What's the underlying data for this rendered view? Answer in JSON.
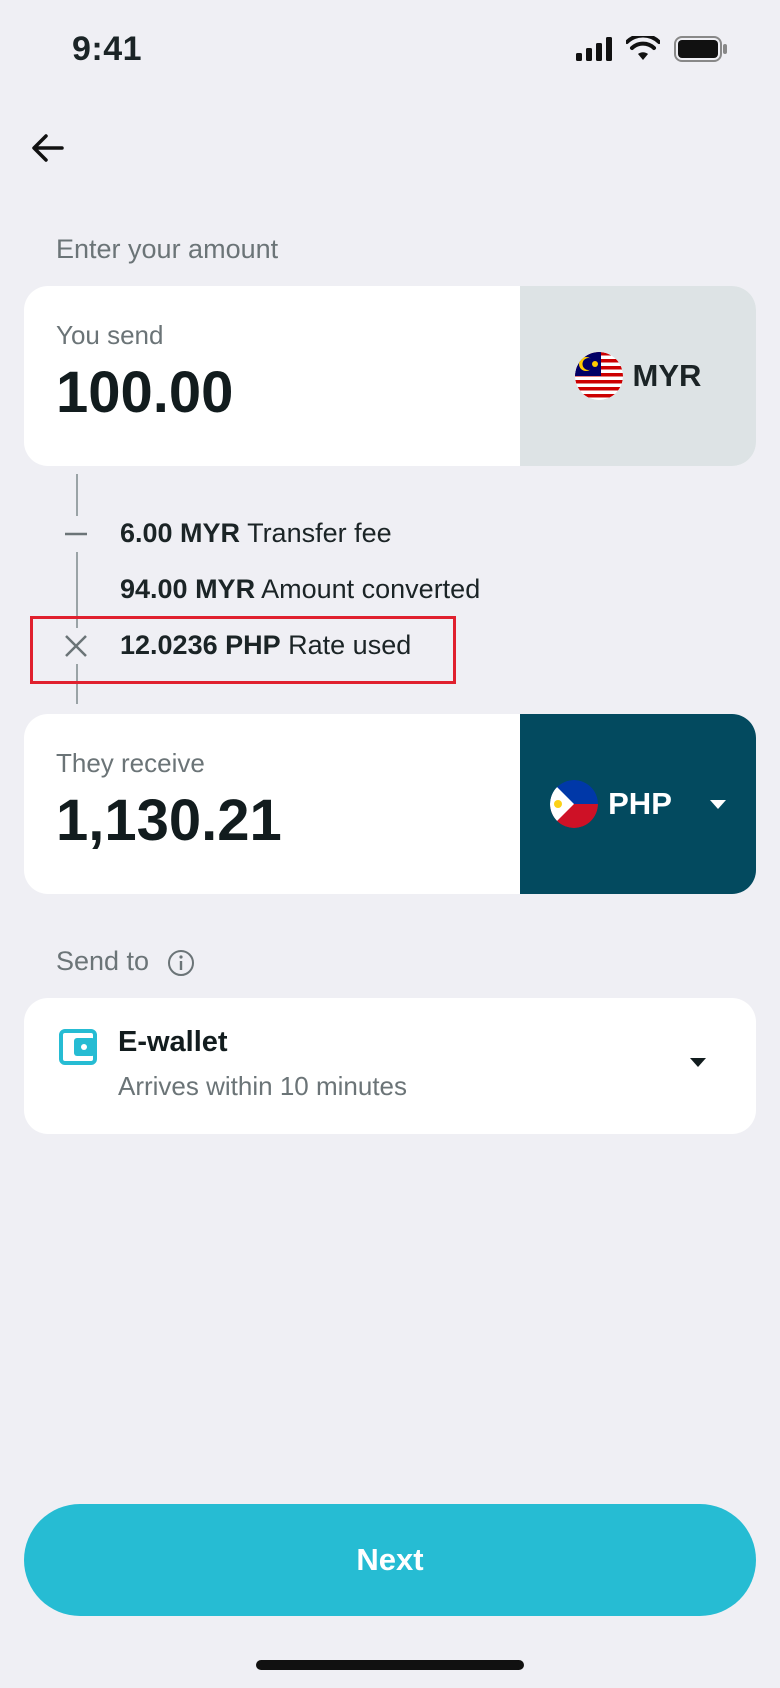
{
  "status_bar": {
    "time": "9:41"
  },
  "page": {
    "amount_label": "Enter your amount"
  },
  "send": {
    "caption": "You send",
    "amount": "100.00",
    "currency": "MYR"
  },
  "breakdown": {
    "fee_amount": "6.00 MYR",
    "fee_label": "Transfer fee",
    "converted_amount": "94.00 MYR",
    "converted_label": "Amount converted",
    "rate_amount": "12.0236 PHP",
    "rate_label": "Rate used"
  },
  "receive": {
    "caption": "They receive",
    "amount": "1,130.21",
    "currency": "PHP"
  },
  "send_to": {
    "label": "Send to",
    "method_title": "E-wallet",
    "method_subtitle": "Arrives within 10 minutes"
  },
  "actions": {
    "next_label": "Next"
  },
  "colors": {
    "accent": "#26bcd3",
    "receive_currency_bg": "#034a5f",
    "send_currency_bg": "#dde3e5",
    "highlight": "#e0202e",
    "background": "#efeff4"
  },
  "icons": [
    "back-arrow-icon",
    "signal-icon",
    "wifi-icon",
    "battery-icon",
    "minus-icon",
    "multiply-icon",
    "info-icon",
    "wallet-icon",
    "malaysia-flag-icon",
    "philippines-flag-icon",
    "chevron-down-icon"
  ]
}
